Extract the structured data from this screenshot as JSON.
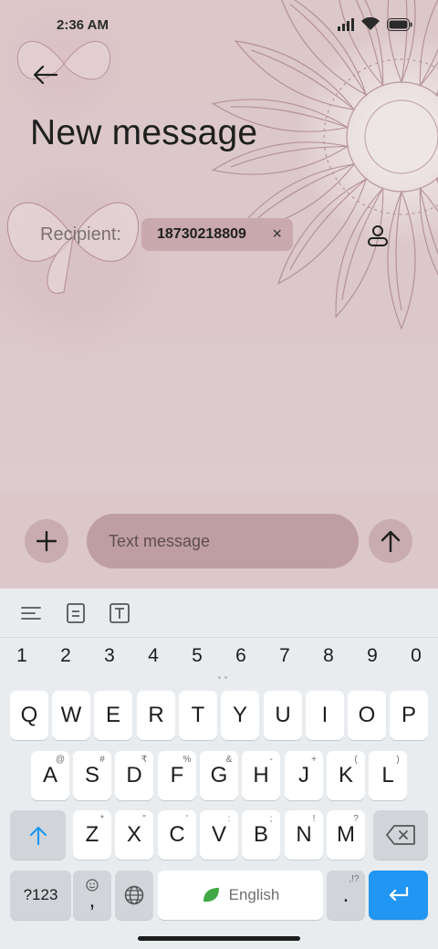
{
  "status": {
    "time": "2:36 AM",
    "icons": [
      "signal-icon",
      "wifi-icon",
      "battery-icon"
    ]
  },
  "header": {
    "back_icon": "arrow-left-icon",
    "title": "New message"
  },
  "recipient": {
    "label": "Recipient:",
    "chip_value": "18730218809",
    "chip_remove": "×",
    "contact_icon": "person-icon"
  },
  "composer": {
    "add_icon": "plus-icon",
    "placeholder": "Text message",
    "value": "",
    "send_icon": "arrow-up-icon"
  },
  "keyboard": {
    "toolbar": [
      "align-icon",
      "clipboard-icon",
      "text-format-icon"
    ],
    "numbers": [
      "1",
      "2",
      "3",
      "4",
      "5",
      "6",
      "7",
      "8",
      "9",
      "0"
    ],
    "row1": [
      "Q",
      "W",
      "E",
      "R",
      "T",
      "Y",
      "U",
      "I",
      "O",
      "P"
    ],
    "row2": [
      {
        "key": "A",
        "hint": "@"
      },
      {
        "key": "S",
        "hint": "#"
      },
      {
        "key": "D",
        "hint": "₹"
      },
      {
        "key": "F",
        "hint": "%"
      },
      {
        "key": "G",
        "hint": "&"
      },
      {
        "key": "H",
        "hint": "-"
      },
      {
        "key": "J",
        "hint": "+"
      },
      {
        "key": "K",
        "hint": "("
      },
      {
        "key": "L",
        "hint": ")"
      }
    ],
    "row3": [
      {
        "key": "Z",
        "hint": "*"
      },
      {
        "key": "X",
        "hint": "\""
      },
      {
        "key": "C",
        "hint": "'"
      },
      {
        "key": "V",
        "hint": ":"
      },
      {
        "key": "B",
        "hint": ";"
      },
      {
        "key": "N",
        "hint": "!"
      },
      {
        "key": "M",
        "hint": "?"
      }
    ],
    "shift_icon": "shift-arrow-icon",
    "backspace_icon": "backspace-icon",
    "symbols_label": "?123",
    "emoji_comma": ",",
    "globe_icon": "globe-icon",
    "space_label": "English",
    "period_label": ".",
    "period_hint": ",!?",
    "enter_icon": "enter-icon"
  },
  "colors": {
    "wallpaper": "#dcc7c9",
    "chip": "#c9a9ad",
    "input": "#bf9ea2",
    "accent_blue": "#2196f3",
    "keyboard_bg": "#e9ecef"
  }
}
